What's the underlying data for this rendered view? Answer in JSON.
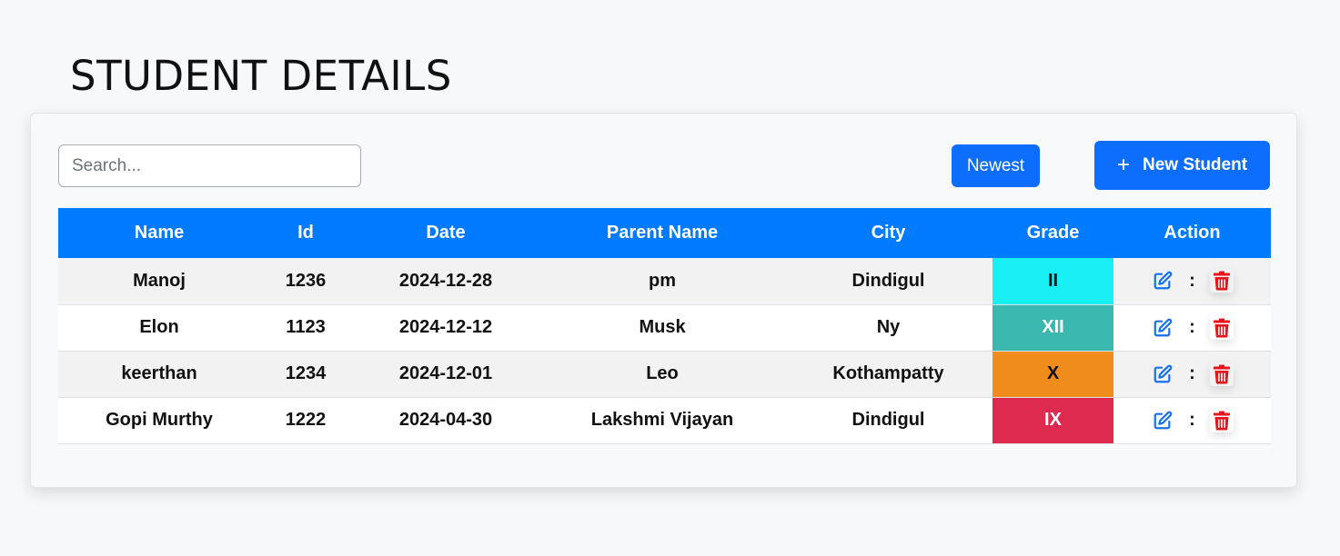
{
  "page": {
    "title": "STUDENT DETAILS"
  },
  "toolbar": {
    "search_placeholder": "Search...",
    "search_value": "",
    "newest_label": "Newest",
    "new_student_label": "New Student",
    "new_student_icon": "plus-icon"
  },
  "table": {
    "columns": [
      "Name",
      "Id",
      "Date",
      "Parent Name",
      "City",
      "Grade",
      "Action"
    ],
    "rows": [
      {
        "name": "Manoj",
        "id": "1236",
        "date": "2024-12-28",
        "parent": "pm",
        "city": "Dindigul",
        "grade": "II",
        "grade_bg": "#18f0f5",
        "grade_fg": "#111111"
      },
      {
        "name": "Elon",
        "id": "1123",
        "date": "2024-12-12",
        "parent": "Musk",
        "city": "Ny",
        "grade": "XII",
        "grade_bg": "#3ab8b0",
        "grade_fg": "#ffffff"
      },
      {
        "name": "keerthan",
        "id": "1234",
        "date": "2024-12-01",
        "parent": "Leo",
        "city": "Kothampatty",
        "grade": "X",
        "grade_bg": "#f08c1c",
        "grade_fg": "#111111"
      },
      {
        "name": "Gopi Murthy",
        "id": "1222",
        "date": "2024-04-30",
        "parent": "Lakshmi Vijayan",
        "city": "Dindigul",
        "grade": "IX",
        "grade_bg": "#df2a50",
        "grade_fg": "#ffffff"
      }
    ],
    "action_separator": ":",
    "edit_icon": "edit-icon",
    "delete_icon": "trash-icon"
  },
  "colors": {
    "accent": "#0d6efd",
    "header_bg": "#007bff",
    "edit_icon": "#1670f0",
    "delete_icon": "#e8141c"
  }
}
